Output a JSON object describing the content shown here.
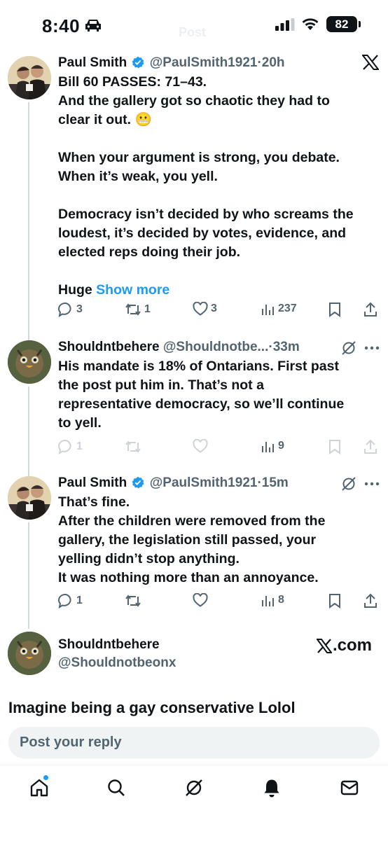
{
  "status_bar": {
    "time": "8:40",
    "battery": "82",
    "header_ghost": "Post"
  },
  "tweets": [
    {
      "name": "Paul Smith",
      "handle": "@PaulSmith1921",
      "time": "20h",
      "verified": true,
      "body": [
        "Bill 60 PASSES: 71–43.",
        "And the gallery got so chaotic they had to",
        "clear it out. 😬",
        "",
        "When your argument is strong, you debate.",
        "When it’s weak, you yell.",
        "",
        "Democracy isn’t decided by who screams the",
        "loudest, it’s decided by votes, evidence, and",
        "elected reps doing their job.",
        ""
      ],
      "truncated_word": "Huge",
      "show_more": "Show more",
      "replies": "3",
      "reposts": "1",
      "likes": "3",
      "views": "237"
    },
    {
      "name": "Shouldntbehere",
      "handle": "@Shouldnotbe...",
      "time": "33m",
      "verified": false,
      "body": [
        "His mandate is 18% of Ontarians. First past",
        "the post put him in. That’s not a",
        "representative democracy, so we’ll continue",
        "to yell."
      ],
      "replies": "1",
      "reposts": "",
      "likes": "",
      "views": "9"
    },
    {
      "name": "Paul Smith",
      "handle": "@PaulSmith1921",
      "time": "15m",
      "verified": true,
      "body": [
        "That’s fine.",
        "After the children were removed from the",
        "gallery, the legislation still passed, your",
        "yelling didn’t stop anything.",
        "It was nothing more than an annoyance."
      ],
      "replies": "1",
      "reposts": "",
      "likes": "",
      "views": "8"
    }
  ],
  "replying_user": {
    "name": "Shouldntbehere",
    "handle": "@Shouldnotbeonx"
  },
  "watermark": ".com",
  "overlay_caption": "Imagine being a gay conservative Lolol",
  "reply_box": {
    "placeholder": "Post your reply"
  },
  "nav": [
    "home-icon",
    "search-icon",
    "grok-icon",
    "notifications-icon",
    "messages-icon"
  ],
  "colors": {
    "link": "#1d9bf0",
    "text": "#0f1419",
    "muted": "#536471",
    "thread": "#cfd9de"
  }
}
